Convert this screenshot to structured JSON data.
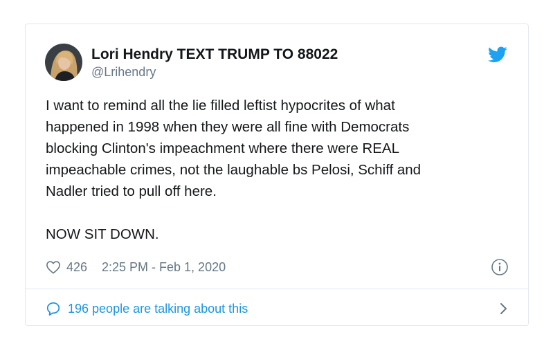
{
  "tweet": {
    "display_name": "Lori Hendry TEXT TRUMP TO 88022",
    "handle": "@Lrihendry",
    "text": "I want to remind all the lie filled leftist hypocrites of what\nhappened in 1998 when they were all fine with Democrats\nblocking Clinton's impeachment where there were REAL\nimpeachable crimes, not the laughable bs Pelosi, Schiff and\nNadler tried to pull off here.\n\nNOW SIT DOWN.",
    "like_count": "426",
    "timestamp": "2:25 PM - Feb 1, 2020",
    "talking_text": "196 people are talking about this"
  },
  "icons": {
    "brand": "twitter-bird-icon",
    "like": "heart-icon",
    "info": "info-icon",
    "reply": "speech-bubble-icon",
    "chevron": "chevron-right-icon"
  },
  "colors": {
    "twitter_blue": "#1da1f2",
    "link_blue": "#1b95e0",
    "muted_text": "#657786",
    "border": "#e1e8ed",
    "text": "#14171a"
  }
}
